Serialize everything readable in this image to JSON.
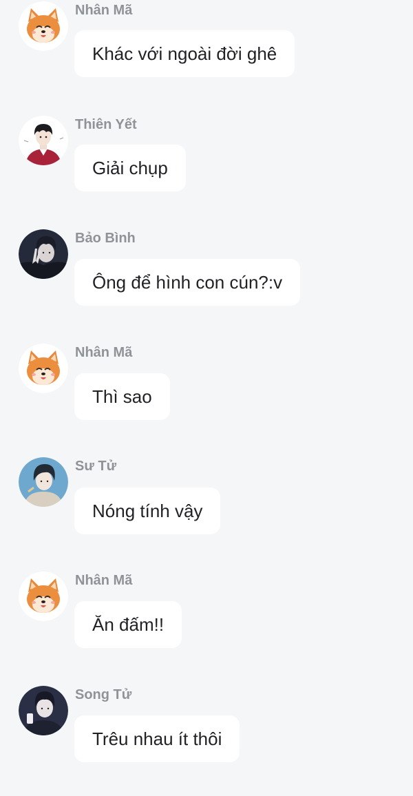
{
  "messages": [
    {
      "sender": "Nhân Mã",
      "text": "Khác với ngoài đời ghê",
      "avatar_icon": "shiba-dog-avatar"
    },
    {
      "sender": "Thiên Yết",
      "text": "Giải chụp",
      "avatar_icon": "boy-red-jacket-avatar"
    },
    {
      "sender": "Bảo Bình",
      "text": "Ông để hình con cún?:v",
      "avatar_icon": "boy-peace-sign-avatar"
    },
    {
      "sender": "Nhân Mã",
      "text": "Thì sao",
      "avatar_icon": "shiba-dog-avatar"
    },
    {
      "sender": "Sư Tử",
      "text": "Nóng tính vậy",
      "avatar_icon": "boy-light-background-avatar"
    },
    {
      "sender": "Nhân Mã",
      "text": "Ăn đấm!!",
      "avatar_icon": "shiba-dog-avatar"
    },
    {
      "sender": "Song Tử",
      "text": "Trêu nhau ít thôi",
      "avatar_icon": "boy-holding-phone-avatar"
    }
  ],
  "colors": {
    "background": "#f5f6f8",
    "bubble": "#ffffff",
    "sender_name": "#8f9297",
    "message_text": "#1f2124"
  }
}
